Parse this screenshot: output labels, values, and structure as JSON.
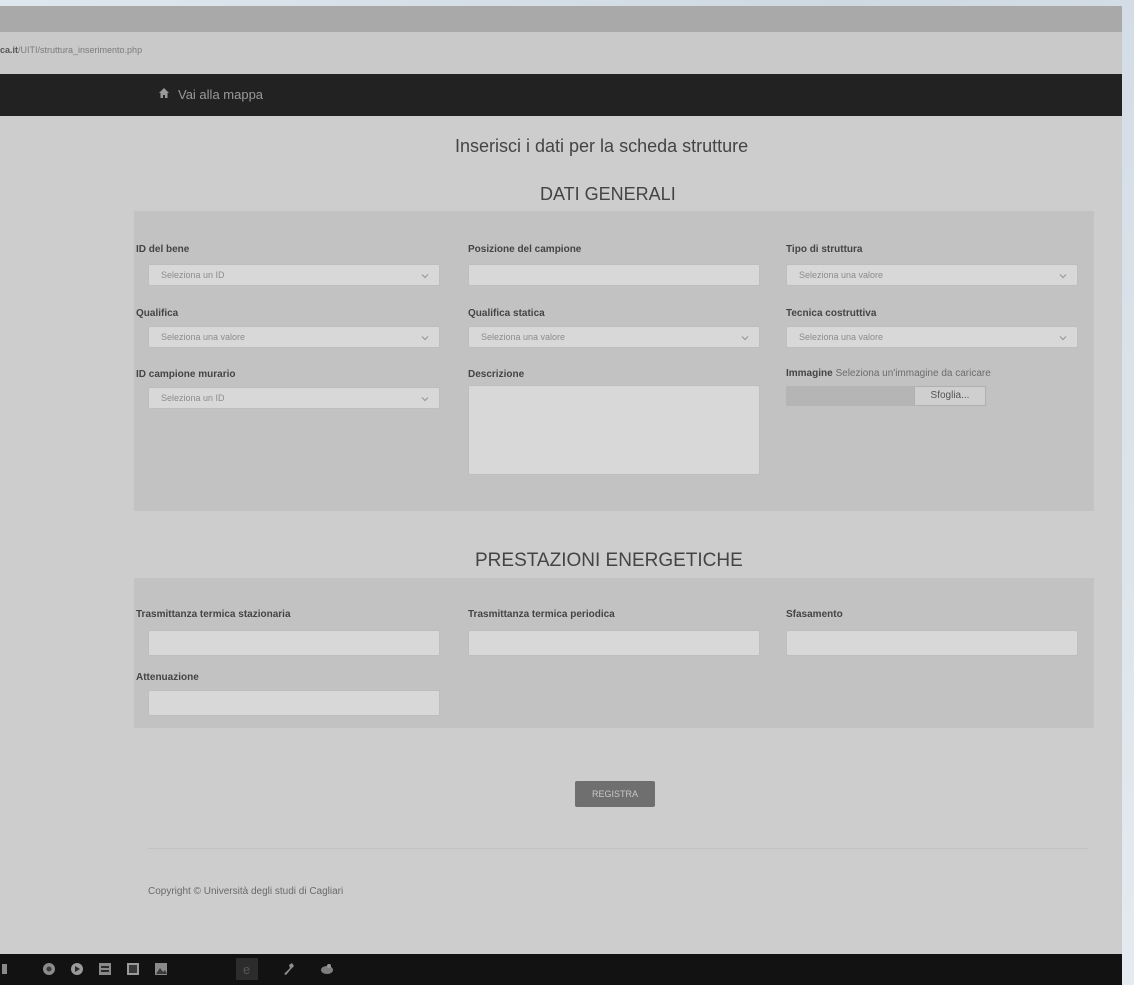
{
  "browser": {
    "url_bold": "ca.it",
    "url_rest": "/UITI/struttura_inserimento.php"
  },
  "navbar": {
    "home_link": "Vai alla mappa",
    "home_icon": "home-icon"
  },
  "page": {
    "title": "Inserisci i dati per la scheda strutture",
    "section1_title": "DATI GENERALI",
    "section2_title": "PRESTAZIONI ENERGETICHE"
  },
  "general": {
    "id_bene": {
      "label": "ID del bene",
      "value": "Seleziona un ID"
    },
    "posizione": {
      "label": "Posizione del campione",
      "value": ""
    },
    "tipo_struttura": {
      "label": "Tipo di struttura",
      "value": "Seleziona una valore"
    },
    "qualifica": {
      "label": "Qualifica",
      "value": "Seleziona una valore"
    },
    "qualifica_statica": {
      "label": "Qualifica statica",
      "value": "Seleziona una valore"
    },
    "tecnica": {
      "label": "Tecnica costruttiva",
      "value": "Seleziona una valore"
    },
    "id_campione": {
      "label": "ID campione murario",
      "value": "Seleziona un ID"
    },
    "descrizione": {
      "label": "Descrizione",
      "value": ""
    },
    "immagine": {
      "label": "Immagine",
      "hint": "Seleziona un'immagine da caricare",
      "browse": "Sfoglia..."
    }
  },
  "energy": {
    "stazionaria": {
      "label": "Trasmittanza termica stazionaria",
      "value": ""
    },
    "periodica": {
      "label": "Trasmittanza termica periodica",
      "value": ""
    },
    "sfasamento": {
      "label": "Sfasamento",
      "value": ""
    },
    "attenuazione": {
      "label": "Attenuazione",
      "value": ""
    }
  },
  "submit_label": "REGISTRA",
  "footer": {
    "copyright": "Copyright © Università degli studi di Cagliari"
  },
  "taskbar": {
    "icons": [
      "start-icon",
      "chrome-icon",
      "media-icon",
      "app-icon",
      "app-icon-2",
      "photo-icon",
      "ie-icon",
      "tool-icon",
      "media-player-icon"
    ]
  }
}
